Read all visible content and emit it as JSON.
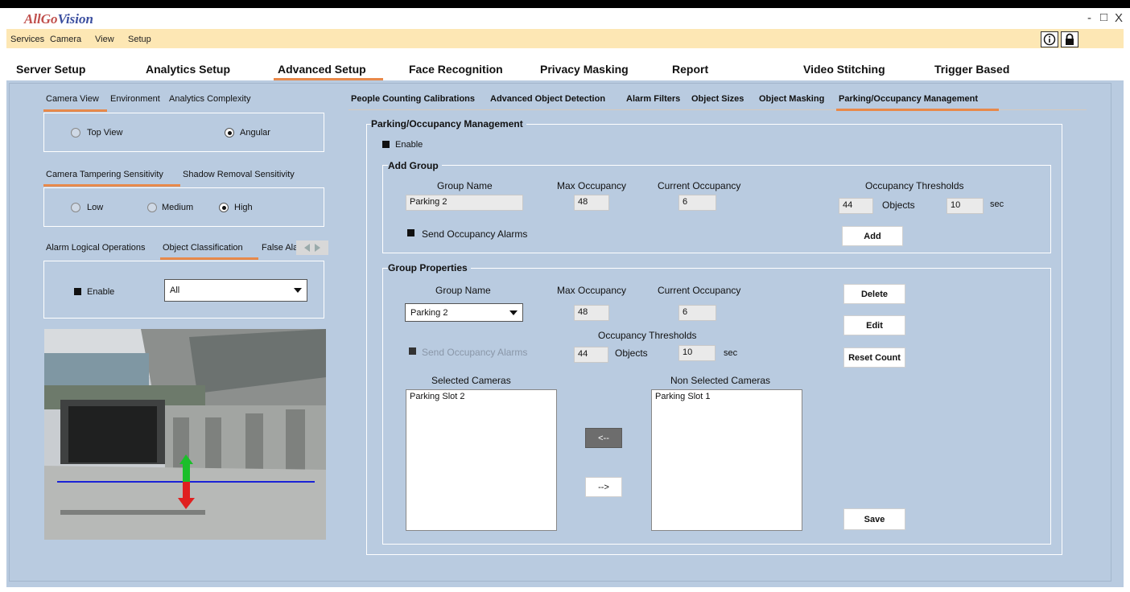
{
  "app": {
    "logo_a": "AllGo",
    "logo_b": "Vision",
    "minimize": "-",
    "maximize": "□",
    "close": "X"
  },
  "menu": [
    "Services",
    "Camera",
    "View",
    "Setup"
  ],
  "tabs": [
    "Server Setup",
    "Analytics Setup",
    "Advanced Setup",
    "Face Recognition",
    "Privacy Masking",
    "Report",
    "Video Stitching",
    "Trigger Based"
  ],
  "left": {
    "subtabs1": [
      "Camera View",
      "Environment",
      "Analytics Complexity"
    ],
    "view_top": "Top View",
    "view_angular": "Angular",
    "subtabs2": [
      "Camera Tampering Sensitivity",
      "Shadow Removal Sensitivity"
    ],
    "sens_low": "Low",
    "sens_medium": "Medium",
    "sens_high": "High",
    "subtabs3": [
      "Alarm Logical Operations",
      "Object Classification",
      "False Ala"
    ],
    "enable": "Enable",
    "class_value": "All"
  },
  "right": {
    "subtabs": [
      "People Counting Calibrations",
      "Advanced Object Detection",
      "Alarm Filters",
      "Object Sizes",
      "Object Masking",
      "Parking/Occupancy Management"
    ],
    "pom_title": "Parking/Occupancy Management",
    "enable": "Enable",
    "add_group": {
      "title": "Add Group",
      "group_name_label": "Group Name",
      "max_occ_label": "Max Occupancy",
      "cur_occ_label": "Current Occupancy",
      "thresholds_label": "Occupancy Thresholds",
      "group_name": "Parking 2",
      "max_occ": "48",
      "cur_occ": "6",
      "thr_objects": "44",
      "objects_label": "Objects",
      "thr_sec": "10",
      "sec_label": "sec",
      "send_alarms": "Send Occupancy Alarms",
      "add_btn": "Add"
    },
    "group_props": {
      "title": "Group Properties",
      "group_name_label": "Group Name",
      "max_occ_label": "Max Occupancy",
      "cur_occ_label": "Current Occupancy",
      "group_name": "Parking 2",
      "max_occ": "48",
      "cur_occ": "6",
      "thresholds_label": "Occupancy Thresholds",
      "send_alarms": "Send Occupancy Alarms",
      "thr_objects": "44",
      "objects_label": "Objects",
      "thr_sec": "10",
      "sec_label": "sec",
      "delete_btn": "Delete",
      "edit_btn": "Edit",
      "reset_btn": "Reset Count",
      "selected_label": "Selected Cameras",
      "nonselected_label": "Non Selected Cameras",
      "selected": [
        "Parking Slot 2"
      ],
      "nonselected": [
        "Parking Slot 1"
      ],
      "move_left": "<--",
      "move_right": "-->",
      "save_btn": "Save"
    }
  },
  "colors": {
    "accent": "#e8894a",
    "panel_bg": "#b9cbe0",
    "menu_bg": "#fde7b4",
    "logo_red": "#c0504d",
    "logo_blue": "#3b4fa0"
  }
}
